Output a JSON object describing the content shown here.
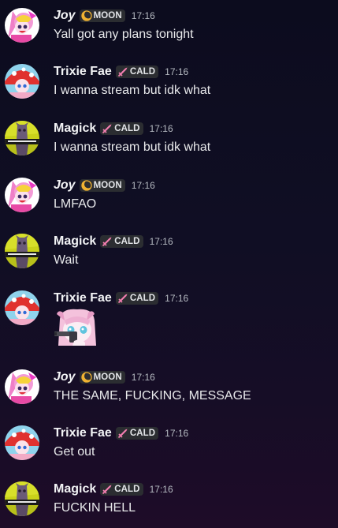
{
  "messages": [
    {
      "user": "Joy",
      "tag": "MOON",
      "time": "17:16",
      "text": "Yall got any plans tonight"
    },
    {
      "user": "Trixie Fae",
      "tag": "CALD",
      "time": "17:16",
      "text": "I wanna stream but idk what"
    },
    {
      "user": "Magick",
      "tag": "CALD",
      "time": "17:16",
      "text": "I wanna stream but idk what"
    },
    {
      "user": "Joy",
      "tag": "MOON",
      "time": "17:16",
      "text": "LMFAO"
    },
    {
      "user": "Magick",
      "tag": "CALD",
      "time": "17:16",
      "text": "Wait"
    },
    {
      "user": "Trixie Fae",
      "tag": "CALD",
      "time": "17:16",
      "sticker": "anime-girl-gun-sticker"
    },
    {
      "user": "Joy",
      "tag": "MOON",
      "time": "17:16",
      "text": "THE SAME, FUCKING, MESSAGE"
    },
    {
      "user": "Trixie Fae",
      "tag": "CALD",
      "time": "17:16",
      "text": "Get out"
    },
    {
      "user": "Magick",
      "tag": "CALD",
      "time": "17:16",
      "text": "FUCKIN HELL"
    }
  ],
  "icons": {
    "MOON": "moon-icon",
    "CALD": "sword-icon"
  },
  "colors": {
    "username": "#f2f3f5",
    "text": "#e8e9eb",
    "timestamp": "#b5bac1",
    "tag_bg": "#2b2d31",
    "moon": "#f0b232",
    "sword": "#f47fb1"
  }
}
